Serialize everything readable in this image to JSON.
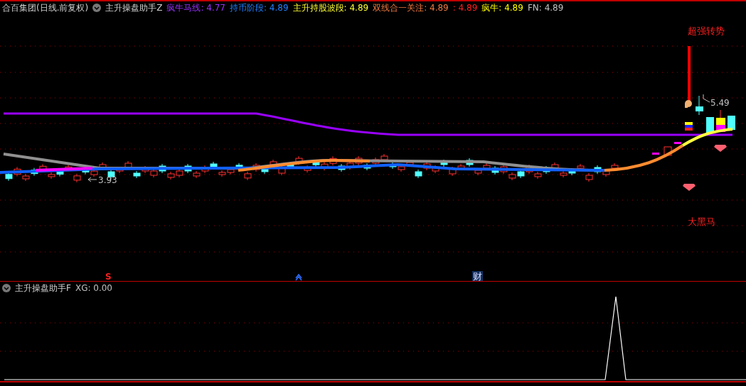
{
  "main_panel": {
    "stock_title": "合百集团(日线.前复权)",
    "indicator_name": "主升操盘助手Z",
    "legend": [
      {
        "text": "疯牛马线: 4.77",
        "color": "#9933ff"
      },
      {
        "text": "持币阶段: 4.89",
        "color": "#2080ff"
      },
      {
        "text": "主升持股波段: 4.89",
        "color": "#ffff33"
      },
      {
        "text": "双线合一关注: 4.89",
        "color": "#f07a40"
      },
      {
        "text": ": 4.89",
        "color": "#ff2020"
      },
      {
        "text": "疯牛: 4.89",
        "color": "#ffff00"
      },
      {
        "text": "FN: 4.89",
        "color": "#c0c0c0"
      }
    ],
    "top_signal": "超强转势",
    "high_price": "5.49",
    "low_price": "3.93",
    "bottom_signal": "大黑马",
    "markers": [
      {
        "kind": "sell",
        "text": "S"
      },
      {
        "kind": "arrow"
      },
      {
        "kind": "finance",
        "text": "财"
      }
    ]
  },
  "sub_panel": {
    "indicator_name": "主升操盘助手F",
    "legend": [
      {
        "text": "XG: 0.00",
        "color": "#c0c0c0"
      }
    ]
  }
}
